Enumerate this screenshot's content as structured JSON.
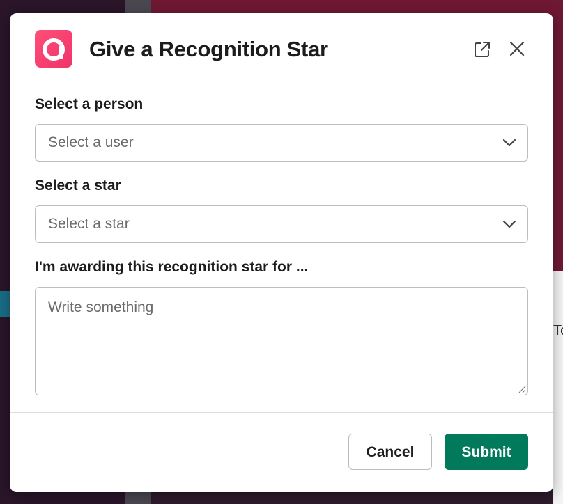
{
  "modal": {
    "title": "Give a Recognition Star",
    "app_icon": "app-logo-icon",
    "header_icons": [
      "external-link-icon",
      "close-icon"
    ]
  },
  "fields": {
    "person": {
      "label": "Select a person",
      "placeholder": "Select a user"
    },
    "star": {
      "label": "Select a star",
      "placeholder": "Select a star"
    },
    "reason": {
      "label": "I'm awarding this recognition star for ...",
      "placeholder": "Write something"
    }
  },
  "footer": {
    "cancel_label": "Cancel",
    "submit_label": "Submit"
  },
  "background": {
    "edge_text": "To"
  },
  "colors": {
    "submit": "#007a5a",
    "logo": "#f0336a",
    "backdrop": "#3a1f36"
  }
}
